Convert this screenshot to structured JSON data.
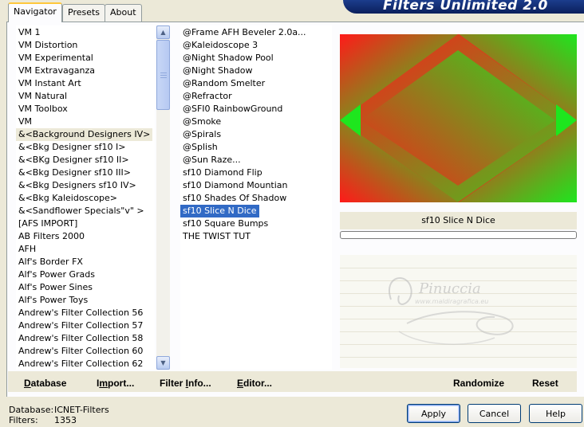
{
  "app": {
    "title": "Filters Unlimited 2.0"
  },
  "tabs": [
    {
      "label": "Navigator",
      "active": true
    },
    {
      "label": "Presets",
      "active": false
    },
    {
      "label": "About",
      "active": false
    }
  ],
  "categories": {
    "items": [
      "VM 1",
      "VM Distortion",
      "VM Experimental",
      "VM Extravaganza",
      "VM Instant Art",
      "VM Natural",
      "VM Toolbox",
      "VM",
      "&<Background Designers IV>",
      "&<Bkg Designer sf10 I>",
      "&<BKg Designer sf10 II>",
      "&<Bkg Designer sf10 III>",
      "&<Bkg Designers sf10 IV>",
      "&<Bkg Kaleidoscope>",
      "&<Sandflower Specials\"v\" >",
      "[AFS IMPORT]",
      "AB Filters 2000",
      "AFH",
      "Alf's Border FX",
      "Alf's Power Grads",
      "Alf's Power Sines",
      "Alf's Power Toys",
      "Andrew's Filter Collection 56",
      "Andrew's Filter Collection 57",
      "Andrew's Filter Collection 58",
      "Andrew's Filter Collection 60",
      "Andrew's Filter Collection 62"
    ],
    "highlighted_index": 8
  },
  "filters": {
    "items": [
      "@Frame AFH Beveler 2.0a...",
      "@Kaleidoscope 3",
      "@Night Shadow Pool",
      "@Night Shadow",
      "@Random Smelter",
      "@Refractor",
      "@SFI0 RainbowGround",
      "@Smoke",
      "@Spirals",
      "@Splish",
      "@Sun Raze...",
      "sf10 Diamond Flip",
      "sf10 Diamond Mountian",
      "sf10 Shades Of Shadow",
      "sf10 Slice N Dice",
      "sf10 Square Bumps",
      "THE TWIST TUT"
    ],
    "selected_index": 14
  },
  "preview": {
    "selected_filter_name": "sf10 Slice N Dice",
    "colors": {
      "red": "#ff1a1a",
      "green": "#1ee61e"
    }
  },
  "watermark": {
    "name": "Pinuccia",
    "site": "www.maldiragrafica.eu"
  },
  "toolbar": {
    "database": "Database",
    "import": "Import...",
    "filter_info": "Filter Info...",
    "editor": "Editor...",
    "randomize": "Randomize",
    "reset": "Reset"
  },
  "status": {
    "database_label": "Database:",
    "database_value": "ICNET-Filters",
    "filters_label": "Filters:",
    "filters_value": "1353"
  },
  "buttons": {
    "apply": "Apply",
    "cancel": "Cancel",
    "help": "Help"
  }
}
